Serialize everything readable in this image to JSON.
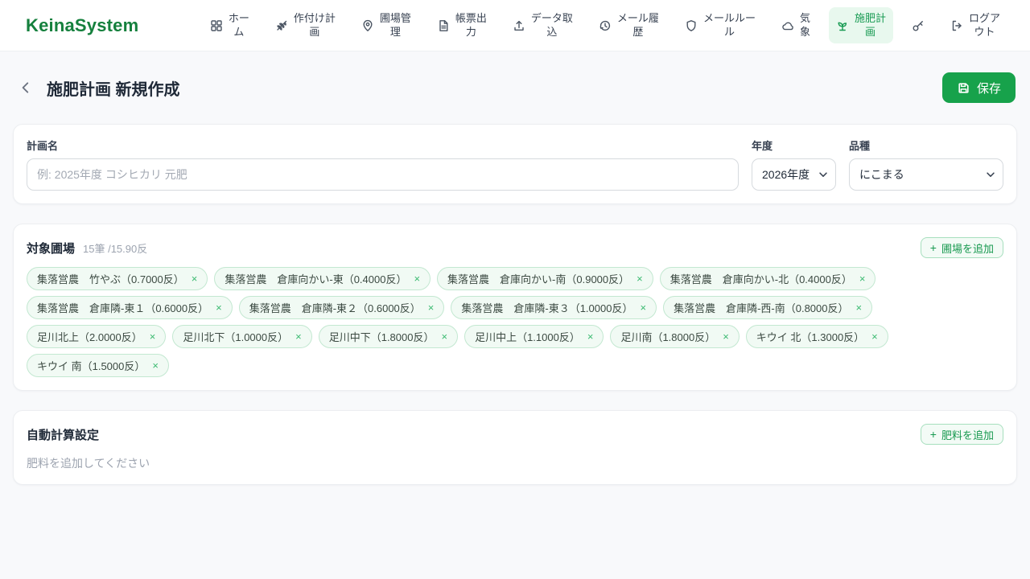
{
  "brand": "KeinaSystem",
  "icons": {
    "plus": "+",
    "close": "×"
  },
  "colors": {
    "primary_green": "#17a24b",
    "brand_green": "#15803d",
    "active_nav_bg": "#e8f8ee",
    "chip_bg": "#f1faf4",
    "chip_border": "#c3e8d1",
    "page_bg": "#f8f9fb"
  },
  "nav": {
    "items": [
      {
        "name": "home",
        "icon": "grid-icon",
        "label": "ホー\nム",
        "active": false
      },
      {
        "name": "planting-plan",
        "icon": "wheat-icon",
        "label": "作付け計\n画",
        "active": false
      },
      {
        "name": "field-management",
        "icon": "map-pin-icon",
        "label": "圃場管\n理",
        "active": false
      },
      {
        "name": "report-output",
        "icon": "document-icon",
        "label": "帳票出\n力",
        "active": false
      },
      {
        "name": "data-import",
        "icon": "upload-icon",
        "label": "データ取\n込",
        "active": false
      },
      {
        "name": "mail-history",
        "icon": "history-icon",
        "label": "メール履\n歴",
        "active": false
      },
      {
        "name": "mail-rules",
        "icon": "shield-icon",
        "label": "メールルー\nル",
        "active": false
      },
      {
        "name": "weather",
        "icon": "cloud-icon",
        "label": "気\n象",
        "active": false
      },
      {
        "name": "fertilization-plan",
        "icon": "sprout-icon",
        "label": "施肥計\n画",
        "active": true
      },
      {
        "name": "key",
        "icon": "key-icon",
        "label": "",
        "active": false
      },
      {
        "name": "logout",
        "icon": "logout-icon",
        "label": "ログア\nウト",
        "active": false
      }
    ]
  },
  "header": {
    "title": "施肥計画 新規作成",
    "save_label": "保存"
  },
  "form": {
    "plan_name": {
      "label": "計画名",
      "value": "",
      "placeholder": "例: 2025年度 コシヒカリ 元肥"
    },
    "year": {
      "label": "年度",
      "value": "2026年度"
    },
    "variety": {
      "label": "品種",
      "value": "にこまる"
    }
  },
  "fields_section": {
    "title": "対象圃場",
    "summary": "15筆 /15.90反",
    "add_button_label": "圃場を追加",
    "tags": [
      "集落営農　竹やぶ（0.7000反）",
      "集落営農　倉庫向かい-東（0.4000反）",
      "集落営農　倉庫向かい-南（0.9000反）",
      "集落営農　倉庫向かい-北（0.4000反）",
      "集落営農　倉庫隣-東１（0.6000反）",
      "集落営農　倉庫隣-東２（0.6000反）",
      "集落営農　倉庫隣-東３（1.0000反）",
      "集落営農　倉庫隣-西-南（0.8000反）",
      "足川北上（2.0000反）",
      "足川北下（1.0000反）",
      "足川中下（1.8000反）",
      "足川中上（1.1000反）",
      "足川南（1.8000反）",
      "キウイ 北（1.3000反）",
      "キウイ 南（1.5000反）"
    ]
  },
  "fertilizer_section": {
    "title": "自動計算設定",
    "add_button_label": "肥料を追加",
    "empty_message": "肥料を追加してください"
  }
}
